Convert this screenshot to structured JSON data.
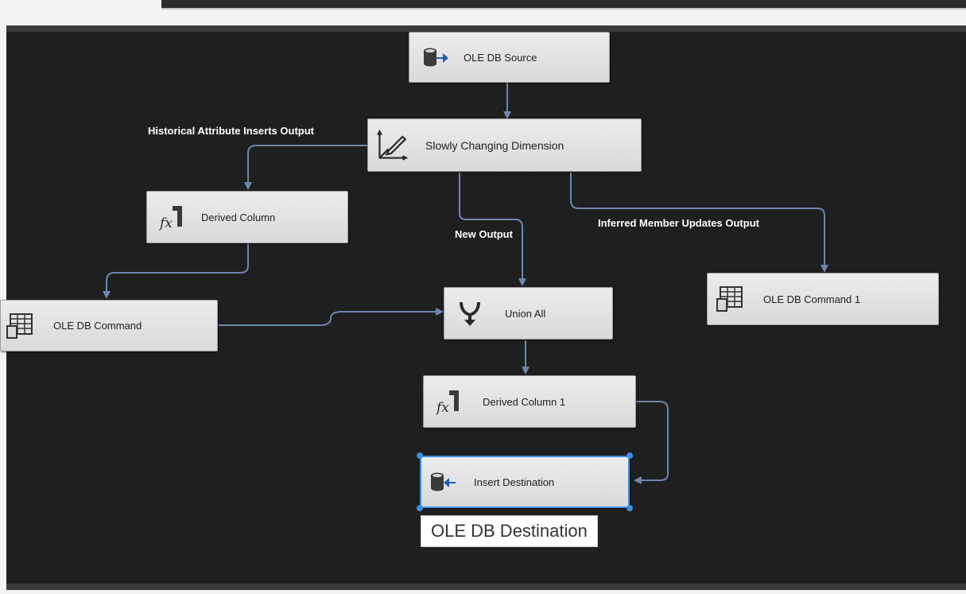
{
  "nodes": {
    "ole_db_source": {
      "label": "OLE DB Source",
      "icon": "database-source-icon"
    },
    "scd": {
      "label": "Slowly Changing Dimension",
      "icon": "scd-edit-icon"
    },
    "derived_column": {
      "label": "Derived Column",
      "icon": "fx-icon"
    },
    "ole_db_command": {
      "label": "OLE DB Command",
      "icon": "table-command-icon"
    },
    "union_all": {
      "label": "Union All",
      "icon": "union-all-icon"
    },
    "ole_db_command_1": {
      "label": "OLE DB Command 1",
      "icon": "table-command-icon"
    },
    "derived_column_1": {
      "label": "Derived Column 1",
      "icon": "fx-icon"
    },
    "insert_destination": {
      "label": "Insert Destination",
      "icon": "database-destination-icon"
    }
  },
  "path_labels": {
    "historical": "Historical Attribute Inserts Output",
    "new_output": "New Output",
    "inferred": "Inferred Member Updates Output"
  },
  "tooltip": {
    "text": "OLE DB Destination"
  },
  "colors": {
    "canvas": "#1f1f1f",
    "node": "#e3e3e3",
    "flow_line": "#6f86ad",
    "selection": "#3c8fe0"
  }
}
